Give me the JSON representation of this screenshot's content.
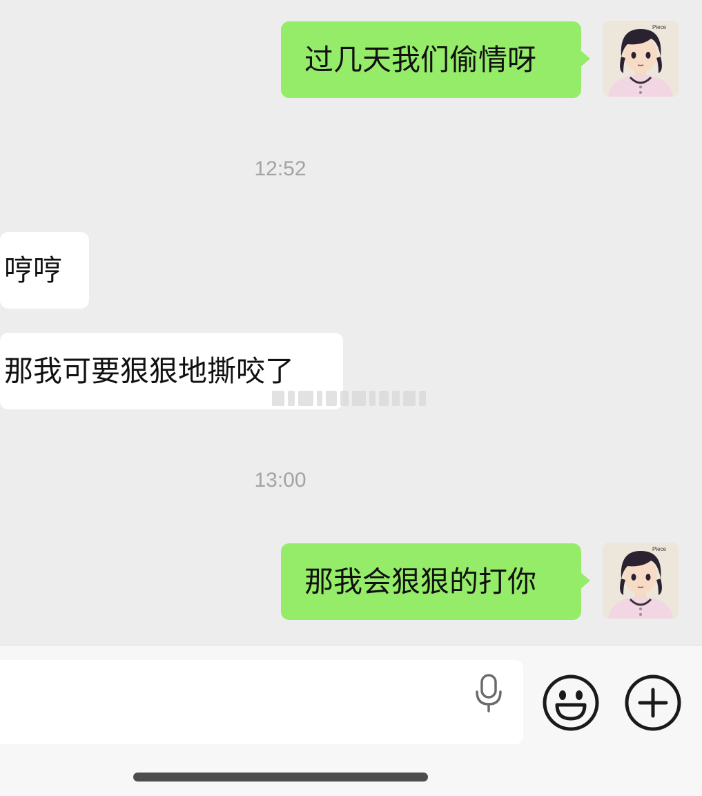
{
  "messages": [
    {
      "direction": "out",
      "text": "过几天我们偷情呀"
    },
    {
      "type": "time",
      "text": "12:52"
    },
    {
      "direction": "in",
      "text": "哼哼"
    },
    {
      "direction": "in",
      "text": "那我可要狠狠地撕咬了"
    },
    {
      "type": "time",
      "text": "13:00"
    },
    {
      "direction": "out",
      "text": "那我会狠狠的打你"
    }
  ],
  "input": {
    "value": "",
    "placeholder": ""
  },
  "icons": {
    "voice": "microphone-icon",
    "emoji": "emoji-icon",
    "more": "plus-icon"
  },
  "colors": {
    "outgoing_bubble": "#95ec69",
    "incoming_bubble": "#ffffff",
    "background": "#ededed",
    "timestamp": "#a3a3a3"
  }
}
